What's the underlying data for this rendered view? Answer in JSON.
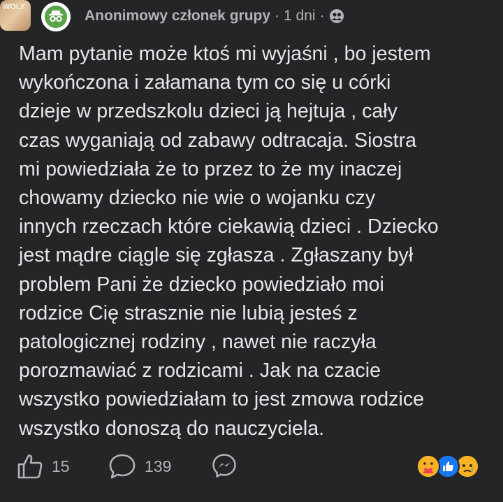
{
  "header": {
    "group_thumb_text": "WOLY",
    "author": "Anonimowy członek grupy",
    "separator": "·",
    "time": "1 dni",
    "separator2": "·",
    "avatar_icon": "anonymous-incognito-icon",
    "privacy_icon": "group-members-icon"
  },
  "post": {
    "text": "Mam pytanie może ktoś mi wyjaśni , bo jestem\nwykończona i załamana tym co się u córki\ndzieje w przedszkolu dzieci ją hejtuja , cały\nczas wyganiają od zabawy odtracaja. Siostra\nmi powiedziała że to przez to że my inaczej\nchowamy dziecko nie wie o wojanku czy\ninnych rzeczach które ciekawią dzieci . Dziecko\njest mądre ciągle się zgłasza . Zgłaszany był\nproblem Pani że dziecko powiedziało moi\nrodzice Cię strasznie nie lubią jesteś z\npatologicznej rodziny , nawet nie raczyła\nporozmawiać z rodzicami . Jak na czacie\nwszystko powiedziałam to jest zmowa rodzice\nwszystko donoszą do nauczyciela."
  },
  "actions": {
    "likes": "15",
    "comments": "139",
    "like_icon": "thumbs-up-icon",
    "comment_icon": "comment-bubble-icon",
    "share_icon": "messenger-icon"
  },
  "reactions": [
    "care",
    "like",
    "sad"
  ],
  "colors": {
    "background": "#242526",
    "text": "#e4e6eb",
    "secondary": "#b0b3b8",
    "like_blue": "#1877f2",
    "reaction_yellow": "#f7b125",
    "avatar_green": "#5ba34a"
  }
}
